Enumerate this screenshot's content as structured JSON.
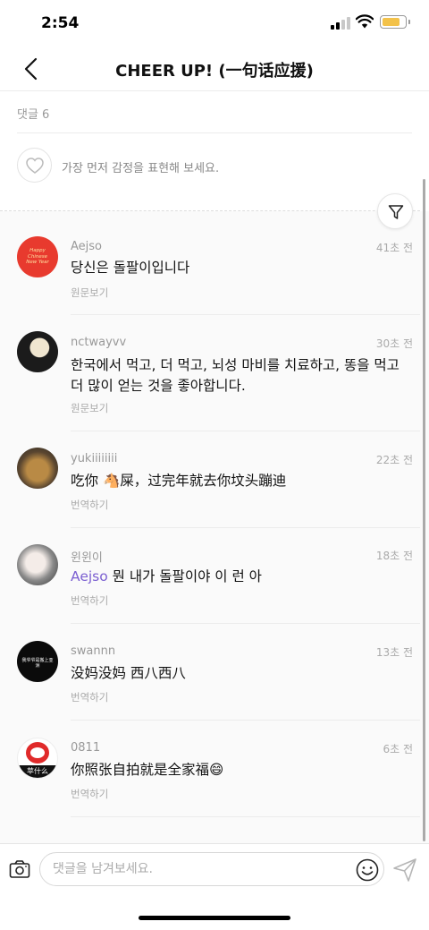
{
  "status": {
    "time": "2:54"
  },
  "header": {
    "title": "CHEER UP! (一句话应援)"
  },
  "comment_count": "댓글 6",
  "reaction": {
    "prompt": "가장 먼저 감정을 표현해 보세요."
  },
  "comments": [
    {
      "user": "Aejso",
      "time": "41초 전",
      "text": "당신은 돌팔이입니다",
      "link": "원문보기",
      "avatar_text": "Happy Chinese New Year"
    },
    {
      "user": "nctwayvv",
      "time": "30초 전",
      "text": "한국에서 먹고, 더 먹고, 뇌성 마비를 치료하고, 똥을 먹고 더 많이 얻는 것을 좋아합니다.",
      "link": "원문보기"
    },
    {
      "user": "yukiiiiiiii",
      "time": "22초 전",
      "text_before": "吃你 ",
      "emoji": "🐴",
      "text_after": "屎，过完年就去你坟头蹦迪",
      "link": "번역하기"
    },
    {
      "user": "윈윈이",
      "time": "18초 전",
      "mention": "Aejso",
      "text": " 뭔 내가 돌팔이야 이 런 아",
      "link": "번역하기"
    },
    {
      "user": "swannn",
      "time": "13초 전",
      "text": "没妈没妈 西八西八",
      "link": "번역하기",
      "avatar_text": "我爷爷是搬上亚洲"
    },
    {
      "user": "0811",
      "time": "6초 전",
      "text": "你照张自拍就是全家福",
      "emoji": "😄",
      "link": "번역하기",
      "avatar_text": "苹什么"
    }
  ],
  "composer": {
    "placeholder": "댓글을 남겨보세요."
  },
  "colors": {
    "mention": "#7b5fd1",
    "battery": "#f3c24a",
    "avatar1": "#e83a2e"
  }
}
